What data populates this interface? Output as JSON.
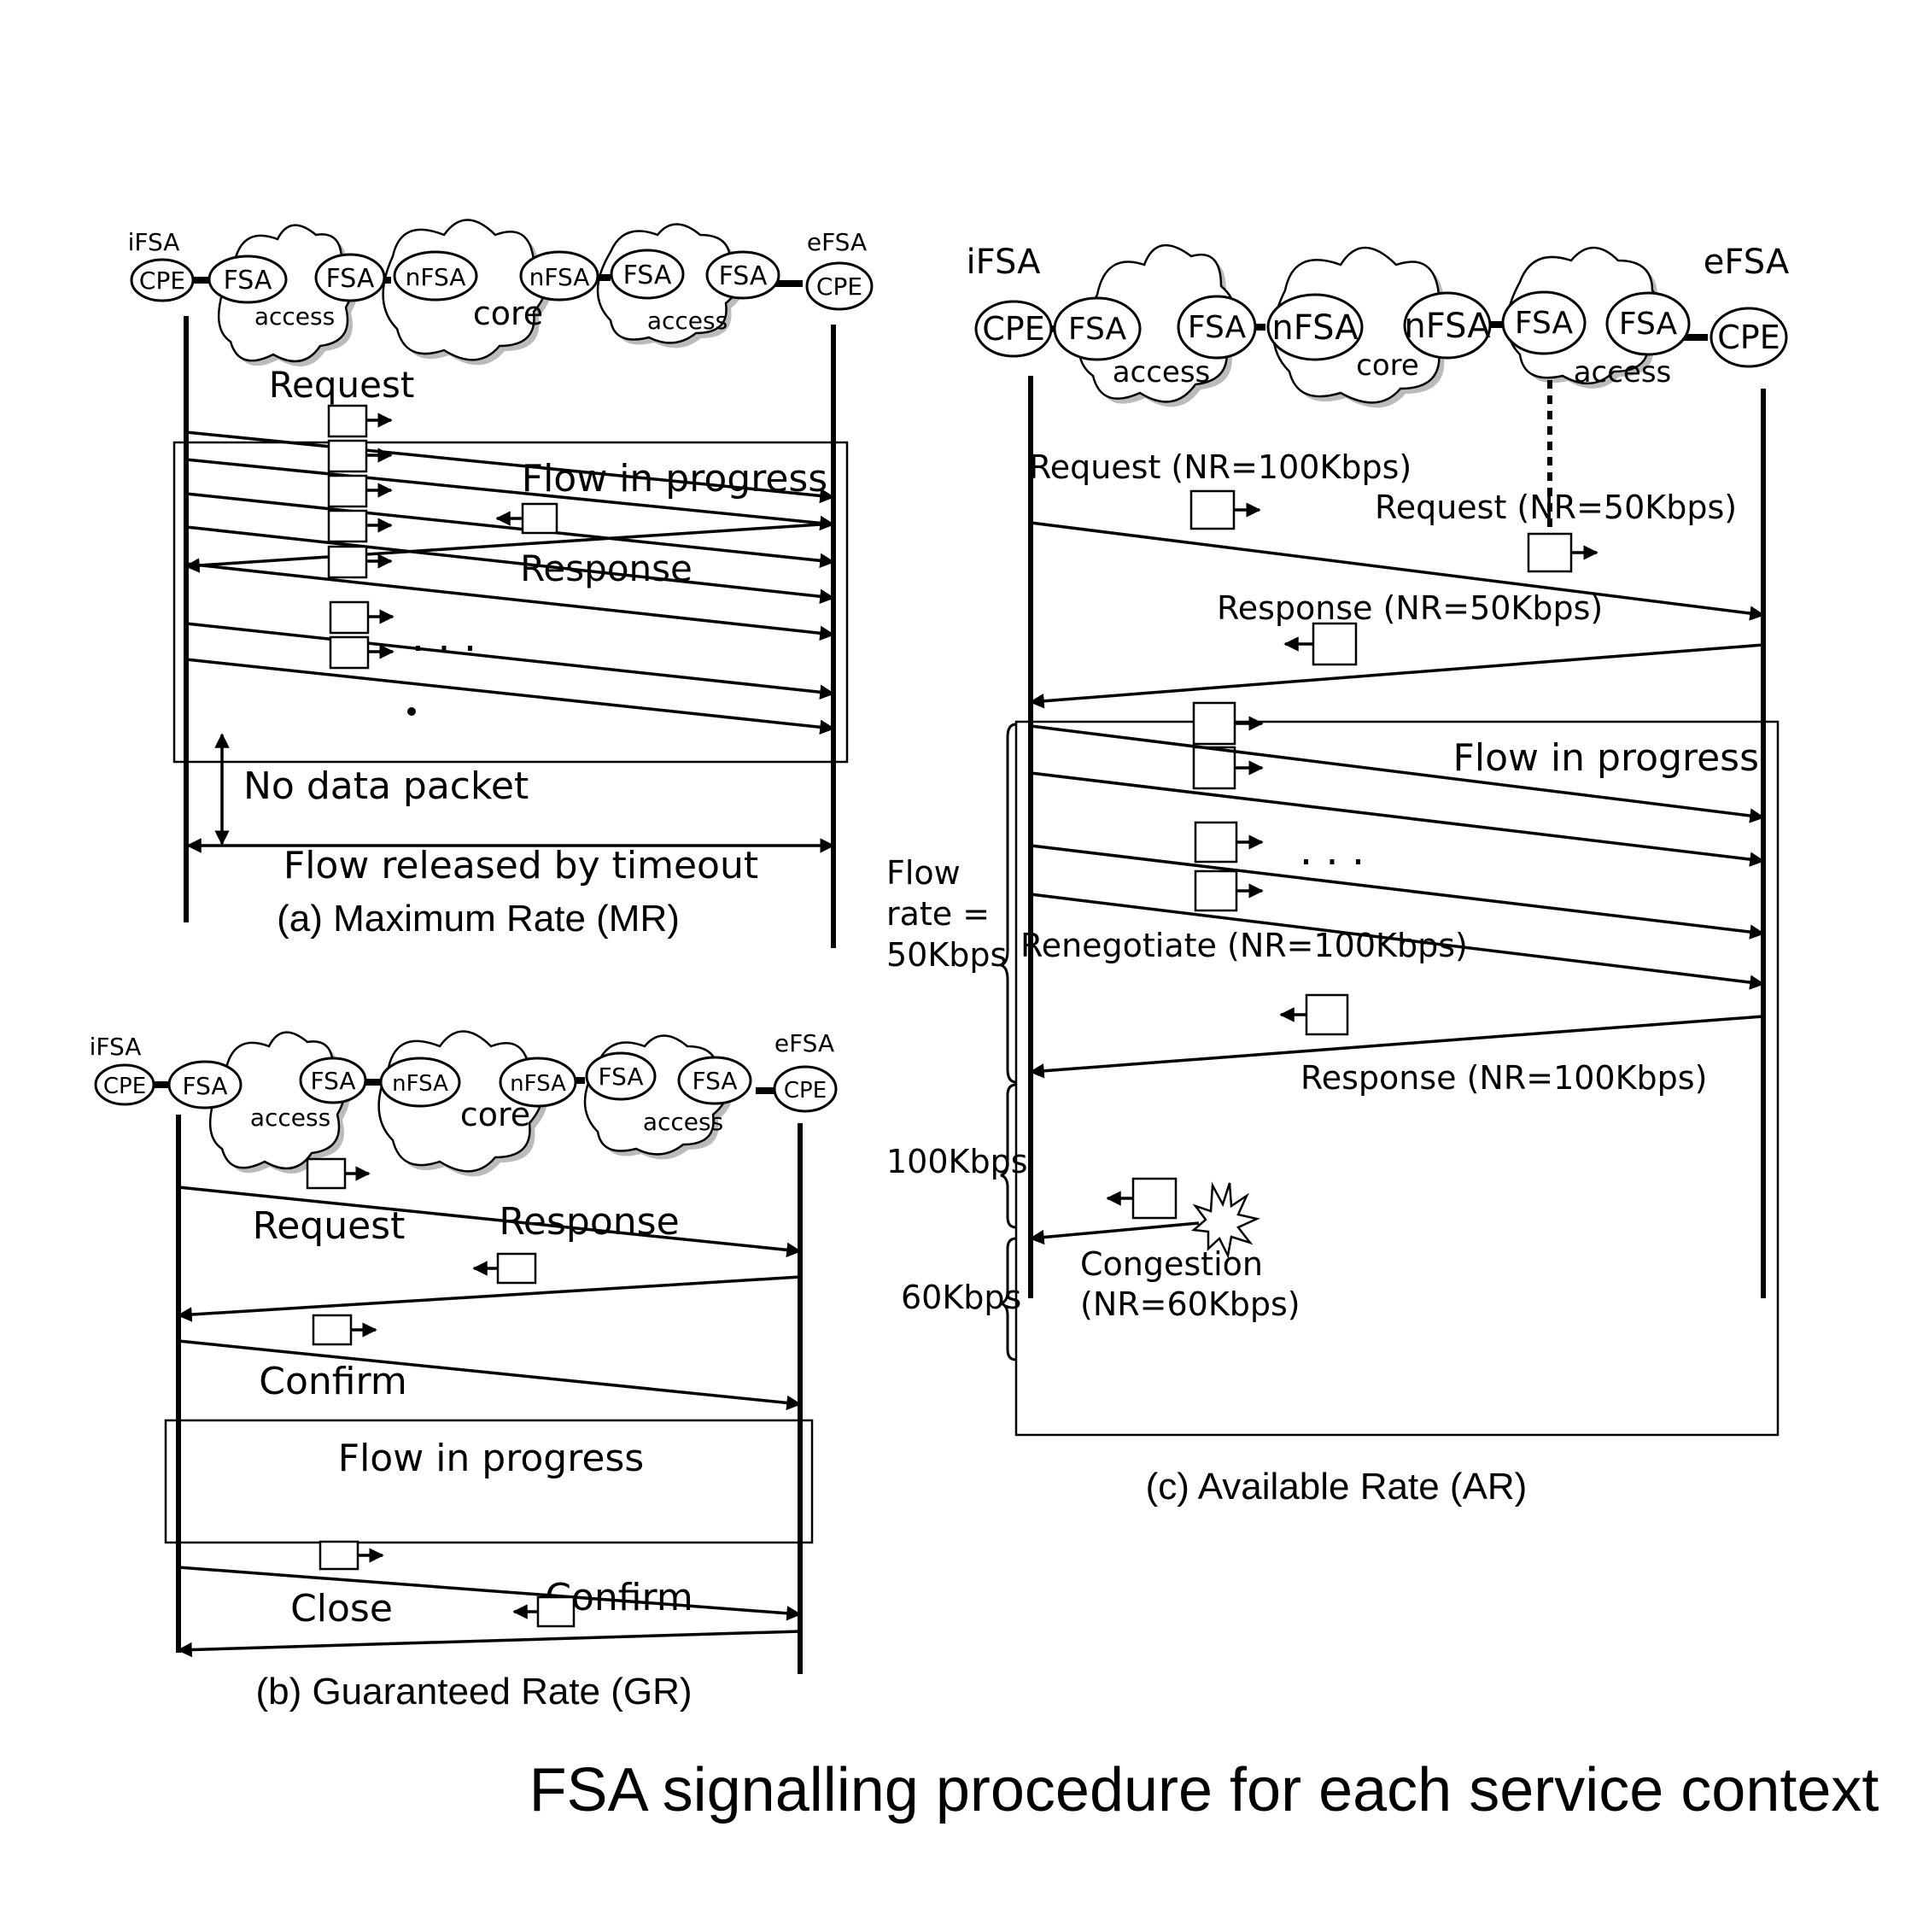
{
  "title": "FSA signalling procedure for each service context",
  "network": {
    "ingress_label": "iFSA",
    "egress_label": "eFSA",
    "nodes": [
      "CPE",
      "FSA",
      "FSA",
      "nFSA",
      "nFSA",
      "FSA",
      "FSA",
      "CPE"
    ],
    "clouds": [
      "access",
      "core",
      "access"
    ]
  },
  "panel_a": {
    "caption": "(a) Maximum Rate (MR)",
    "request_label": "Request",
    "flow_label": "Flow in progress",
    "response_label": "Response",
    "ellipsis": ". . .",
    "no_data_label": "No data packet",
    "timeout_label": "Flow released by timeout"
  },
  "panel_b": {
    "caption": "(b) Guaranteed Rate (GR)",
    "request_label": "Request",
    "response_label": "Response",
    "confirm_label": "Confirm",
    "flow_label": "Flow in progress",
    "close_label": "Close",
    "close_confirm_label": "Confirm"
  },
  "panel_c": {
    "caption": "(c) Available Rate (AR)",
    "request1_label": "Request (NR=100Kbps)",
    "request2_label": "Request (NR=50Kbps)",
    "response1_label": "Response (NR=50Kbps)",
    "flow_label": "Flow in progress",
    "ellipsis": ". . .",
    "renegotiate_label": "Renegotiate (NR=100Kbps)",
    "response2_label": "Response (NR=100Kbps)",
    "congestion_label": "Congestion",
    "congestion_nr_label": "(NR=60Kbps)",
    "rate_labels": {
      "flow_rate_line1": "Flow",
      "flow_rate_line2": "rate =",
      "rate_50": "50Kbps",
      "rate_100": "100Kbps",
      "rate_60": "60Kbps"
    }
  }
}
